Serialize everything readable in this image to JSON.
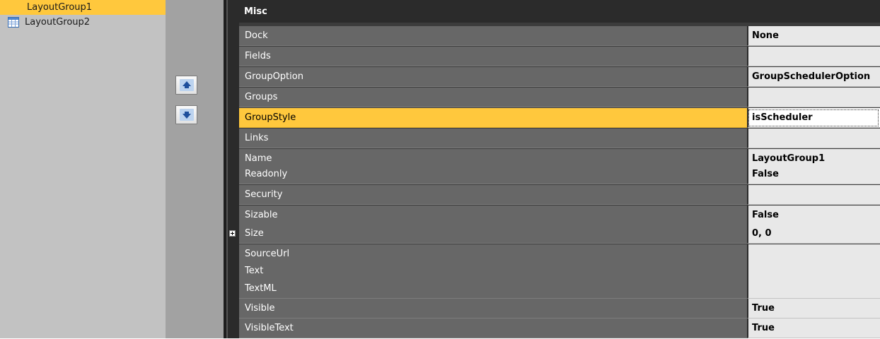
{
  "tree": {
    "items": [
      {
        "label": "LayoutGroup1",
        "selected": true
      },
      {
        "label": "LayoutGroup2",
        "selected": false,
        "icon": "layout-group-icon"
      }
    ]
  },
  "mover": {
    "up_icon": "arrow-up-icon",
    "down_icon": "arrow-down-icon"
  },
  "properties": {
    "category": "Misc",
    "rows": [
      {
        "name": "Dock",
        "value": "None"
      },
      {
        "name": "Fields",
        "value": ""
      },
      {
        "name": "GroupOption",
        "value": "GroupSchedulerOption"
      },
      {
        "name": "Groups",
        "value": ""
      },
      {
        "name": "GroupStyle",
        "value": "isScheduler",
        "selected": true
      },
      {
        "name": "Links",
        "value": ""
      },
      {
        "name": "Name",
        "value": "LayoutGroup1"
      },
      {
        "name": "Readonly",
        "value": "False"
      },
      {
        "name": "Security",
        "value": ""
      },
      {
        "name": "Sizable",
        "value": "False"
      },
      {
        "name": "Size",
        "value": "0, 0",
        "expandable": true
      },
      {
        "name": "SourceUrl",
        "value": ""
      },
      {
        "name": "Text",
        "value": ""
      },
      {
        "name": "TextML",
        "value": ""
      },
      {
        "name": "Visible",
        "value": "True"
      },
      {
        "name": "VisibleText",
        "value": "True"
      }
    ]
  },
  "colors": {
    "selection": "#ffc83d",
    "name_cell": "#676767",
    "value_cell": "#e8e8e8",
    "header": "#2b2b2b"
  }
}
